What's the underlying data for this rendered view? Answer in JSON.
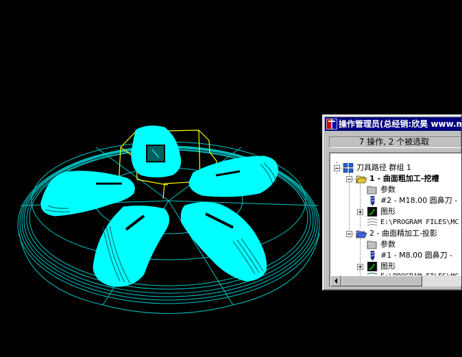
{
  "ops_manager": {
    "title": "操作管理员(总经销:欣昊 www.m",
    "status": "7 操作, 2 个被选取",
    "tree": {
      "root": "刀具路径 群组 1",
      "ops": [
        {
          "label": "1 - 曲面粗加工-挖槽",
          "params": "参数",
          "tool": "#2 - M18.00 圆鼻刀 -",
          "graphics": "图形",
          "file": "E:\\PROGRAM FILES\\MC"
        },
        {
          "label": "2 - 曲面精加工-投影",
          "params": "参数",
          "tool": "#1 - M8.00 圆鼻刀 -",
          "graphics": "图形",
          "file": "E:\\PROGRAM FILES\\MC"
        }
      ]
    },
    "icons": {
      "app": "mastercam-app-icon",
      "root": "toolpath-group-icon",
      "operation": "open-folder-icon",
      "params": "folder-icon",
      "tool": "end-mill-tool-icon",
      "graphics": "geometry-icon",
      "file": "nc-file-icon"
    }
  },
  "viewport": {
    "colors": {
      "background": "#000000",
      "wireframe": "#00c8c8",
      "surface": "#00ffff",
      "boundary": "#ffff00"
    }
  }
}
